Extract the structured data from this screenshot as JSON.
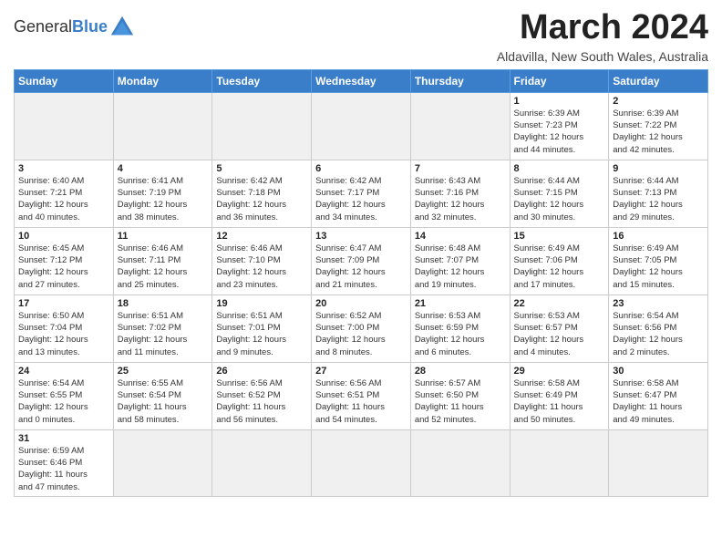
{
  "logo": {
    "text_general": "General",
    "text_blue": "Blue"
  },
  "header": {
    "month_title": "March 2024",
    "subtitle": "Aldavilla, New South Wales, Australia"
  },
  "weekdays": [
    "Sunday",
    "Monday",
    "Tuesday",
    "Wednesday",
    "Thursday",
    "Friday",
    "Saturday"
  ],
  "weeks": [
    [
      {
        "day": "",
        "info": ""
      },
      {
        "day": "",
        "info": ""
      },
      {
        "day": "",
        "info": ""
      },
      {
        "day": "",
        "info": ""
      },
      {
        "day": "",
        "info": ""
      },
      {
        "day": "1",
        "info": "Sunrise: 6:39 AM\nSunset: 7:23 PM\nDaylight: 12 hours\nand 44 minutes."
      },
      {
        "day": "2",
        "info": "Sunrise: 6:39 AM\nSunset: 7:22 PM\nDaylight: 12 hours\nand 42 minutes."
      }
    ],
    [
      {
        "day": "3",
        "info": "Sunrise: 6:40 AM\nSunset: 7:21 PM\nDaylight: 12 hours\nand 40 minutes."
      },
      {
        "day": "4",
        "info": "Sunrise: 6:41 AM\nSunset: 7:19 PM\nDaylight: 12 hours\nand 38 minutes."
      },
      {
        "day": "5",
        "info": "Sunrise: 6:42 AM\nSunset: 7:18 PM\nDaylight: 12 hours\nand 36 minutes."
      },
      {
        "day": "6",
        "info": "Sunrise: 6:42 AM\nSunset: 7:17 PM\nDaylight: 12 hours\nand 34 minutes."
      },
      {
        "day": "7",
        "info": "Sunrise: 6:43 AM\nSunset: 7:16 PM\nDaylight: 12 hours\nand 32 minutes."
      },
      {
        "day": "8",
        "info": "Sunrise: 6:44 AM\nSunset: 7:15 PM\nDaylight: 12 hours\nand 30 minutes."
      },
      {
        "day": "9",
        "info": "Sunrise: 6:44 AM\nSunset: 7:13 PM\nDaylight: 12 hours\nand 29 minutes."
      }
    ],
    [
      {
        "day": "10",
        "info": "Sunrise: 6:45 AM\nSunset: 7:12 PM\nDaylight: 12 hours\nand 27 minutes."
      },
      {
        "day": "11",
        "info": "Sunrise: 6:46 AM\nSunset: 7:11 PM\nDaylight: 12 hours\nand 25 minutes."
      },
      {
        "day": "12",
        "info": "Sunrise: 6:46 AM\nSunset: 7:10 PM\nDaylight: 12 hours\nand 23 minutes."
      },
      {
        "day": "13",
        "info": "Sunrise: 6:47 AM\nSunset: 7:09 PM\nDaylight: 12 hours\nand 21 minutes."
      },
      {
        "day": "14",
        "info": "Sunrise: 6:48 AM\nSunset: 7:07 PM\nDaylight: 12 hours\nand 19 minutes."
      },
      {
        "day": "15",
        "info": "Sunrise: 6:49 AM\nSunset: 7:06 PM\nDaylight: 12 hours\nand 17 minutes."
      },
      {
        "day": "16",
        "info": "Sunrise: 6:49 AM\nSunset: 7:05 PM\nDaylight: 12 hours\nand 15 minutes."
      }
    ],
    [
      {
        "day": "17",
        "info": "Sunrise: 6:50 AM\nSunset: 7:04 PM\nDaylight: 12 hours\nand 13 minutes."
      },
      {
        "day": "18",
        "info": "Sunrise: 6:51 AM\nSunset: 7:02 PM\nDaylight: 12 hours\nand 11 minutes."
      },
      {
        "day": "19",
        "info": "Sunrise: 6:51 AM\nSunset: 7:01 PM\nDaylight: 12 hours\nand 9 minutes."
      },
      {
        "day": "20",
        "info": "Sunrise: 6:52 AM\nSunset: 7:00 PM\nDaylight: 12 hours\nand 8 minutes."
      },
      {
        "day": "21",
        "info": "Sunrise: 6:53 AM\nSunset: 6:59 PM\nDaylight: 12 hours\nand 6 minutes."
      },
      {
        "day": "22",
        "info": "Sunrise: 6:53 AM\nSunset: 6:57 PM\nDaylight: 12 hours\nand 4 minutes."
      },
      {
        "day": "23",
        "info": "Sunrise: 6:54 AM\nSunset: 6:56 PM\nDaylight: 12 hours\nand 2 minutes."
      }
    ],
    [
      {
        "day": "24",
        "info": "Sunrise: 6:54 AM\nSunset: 6:55 PM\nDaylight: 12 hours\nand 0 minutes."
      },
      {
        "day": "25",
        "info": "Sunrise: 6:55 AM\nSunset: 6:54 PM\nDaylight: 11 hours\nand 58 minutes."
      },
      {
        "day": "26",
        "info": "Sunrise: 6:56 AM\nSunset: 6:52 PM\nDaylight: 11 hours\nand 56 minutes."
      },
      {
        "day": "27",
        "info": "Sunrise: 6:56 AM\nSunset: 6:51 PM\nDaylight: 11 hours\nand 54 minutes."
      },
      {
        "day": "28",
        "info": "Sunrise: 6:57 AM\nSunset: 6:50 PM\nDaylight: 11 hours\nand 52 minutes."
      },
      {
        "day": "29",
        "info": "Sunrise: 6:58 AM\nSunset: 6:49 PM\nDaylight: 11 hours\nand 50 minutes."
      },
      {
        "day": "30",
        "info": "Sunrise: 6:58 AM\nSunset: 6:47 PM\nDaylight: 11 hours\nand 49 minutes."
      }
    ],
    [
      {
        "day": "31",
        "info": "Sunrise: 6:59 AM\nSunset: 6:46 PM\nDaylight: 11 hours\nand 47 minutes."
      },
      {
        "day": "",
        "info": ""
      },
      {
        "day": "",
        "info": ""
      },
      {
        "day": "",
        "info": ""
      },
      {
        "day": "",
        "info": ""
      },
      {
        "day": "",
        "info": ""
      },
      {
        "day": "",
        "info": ""
      }
    ]
  ]
}
